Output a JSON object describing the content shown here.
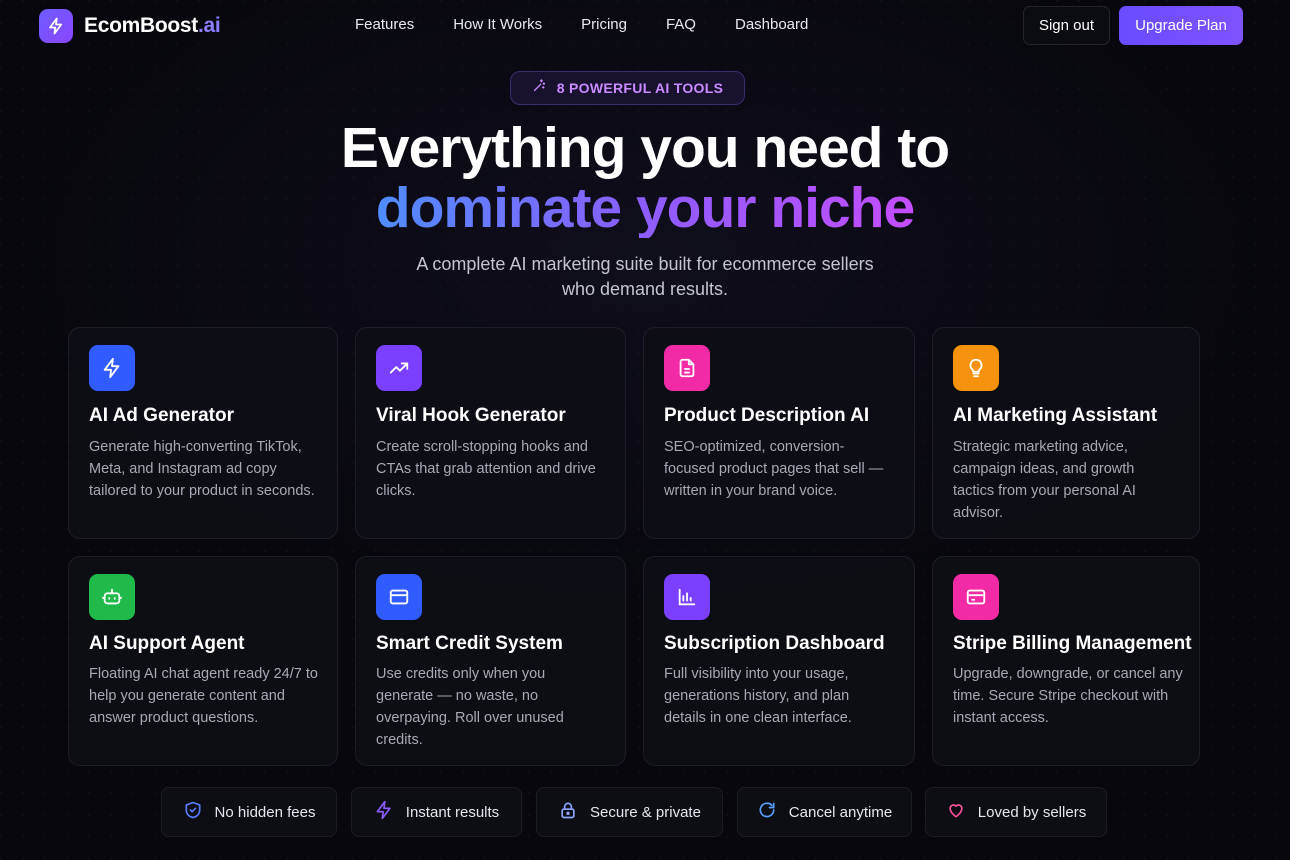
{
  "brand": {
    "name": "EcomBoost",
    "suffix": ".ai"
  },
  "nav": {
    "links": [
      "Features",
      "How It Works",
      "Pricing",
      "FAQ",
      "Dashboard"
    ],
    "sign_out": "Sign out",
    "upgrade": "Upgrade Plan"
  },
  "hero": {
    "badge": "8 POWERFUL AI TOOLS",
    "title_line1": "Everything you need to",
    "title_line2": "dominate your niche",
    "subtitle_line1": "A complete AI marketing suite built for ecommerce sellers",
    "subtitle_line2": "who demand results."
  },
  "features": [
    {
      "icon": "bolt-icon",
      "color": "#2f5bff",
      "title": "AI Ad Generator",
      "desc": "Generate high-converting TikTok, Meta, and Instagram ad copy tailored to your product in seconds."
    },
    {
      "icon": "trending-up-icon",
      "color": "#7b3fff",
      "title": "Viral Hook Generator",
      "desc": "Create scroll-stopping hooks and CTAs that grab attention and drive clicks."
    },
    {
      "icon": "document-icon",
      "color": "#f22aa6",
      "title": "Product Description AI",
      "desc": "SEO-optimized, conversion-focused product pages that sell — written in your brand voice."
    },
    {
      "icon": "lightbulb-icon",
      "color": "#f5930f",
      "title": "AI Marketing Assistant",
      "desc": "Strategic marketing advice, campaign ideas, and growth tactics from your personal AI advisor."
    },
    {
      "icon": "robot-icon",
      "color": "#1fba4a",
      "title": "AI Support Agent",
      "desc": "Floating AI chat agent ready 24/7 to help you generate content and answer product questions."
    },
    {
      "icon": "credit-card-icon",
      "color": "#2f5bff",
      "title": "Smart Credit System",
      "desc": "Use credits only when you generate — no waste, no overpaying. Roll over unused credits."
    },
    {
      "icon": "bar-chart-icon",
      "color": "#7b3fff",
      "title": "Subscription Dashboard",
      "desc": "Full visibility into your usage, generations history, and plan details in one clean interface."
    },
    {
      "icon": "credit-card-icon",
      "color": "#f22aa6",
      "title": "Stripe Billing Management",
      "desc": "Upgrade, downgrade, or cancel any time. Secure Stripe checkout with instant access."
    }
  ],
  "trust": [
    {
      "icon": "shield-check-icon",
      "color": "#5a7dff",
      "label": "No hidden fees"
    },
    {
      "icon": "bolt-icon",
      "color": "#8b5cff",
      "label": "Instant results"
    },
    {
      "icon": "lock-icon",
      "color": "#8aa6ff",
      "label": "Secure & private"
    },
    {
      "icon": "refresh-icon",
      "color": "#5aa0ff",
      "label": "Cancel anytime"
    },
    {
      "icon": "heart-icon",
      "color": "#ff4f9a",
      "label": "Loved by sellers"
    }
  ]
}
